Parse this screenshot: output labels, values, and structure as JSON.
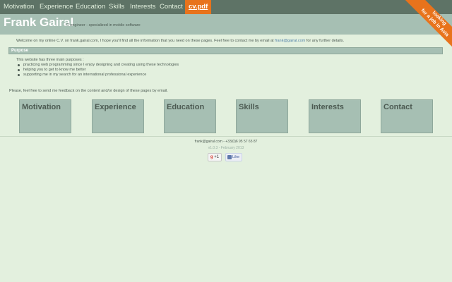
{
  "nav": {
    "items": [
      {
        "label": "Motivation"
      },
      {
        "label": "Experience"
      },
      {
        "label": "Education"
      },
      {
        "label": "Skills"
      },
      {
        "label": "Interests"
      },
      {
        "label": "Contact"
      }
    ],
    "cv_label": "cv.pdf"
  },
  "header": {
    "name": "Frank Gairal",
    "tagline": "IT engineer - specialized in mobile software"
  },
  "ribbon": {
    "line1": "looking",
    "line2": "for a job in Asia"
  },
  "content": {
    "welcome_text": "Welcome on my online C.V. on frank.gairal.com, I hope you'll find all the information that you need on these pages. Feel free to contact me by email at ",
    "welcome_email": "frank@gairal.com",
    "welcome_suffix": " for any further details.",
    "section_title": "Purpose",
    "intro": "This website has three main purposes :",
    "purposes": [
      "practicing web programming since I enjoy designing and creating using these technologies",
      "helping you to get to know me better",
      "supporting me in my search for an international professional experience"
    ],
    "feedback": "Please, feel free to send me feedback on the content and/or design of these pages by email."
  },
  "tiles": [
    {
      "label": "Motivation"
    },
    {
      "label": "Experience"
    },
    {
      "label": "Education"
    },
    {
      "label": "Skills"
    },
    {
      "label": "Interests"
    },
    {
      "label": "Contact"
    }
  ],
  "footer": {
    "contact": "frank@gairal.com - +33(0)6 95 57 65 87",
    "version": "v1.0.3 - February 2013",
    "gplus_label": "+1",
    "like_label": "Like"
  },
  "colors": {
    "nav_bg": "#5e7366",
    "accent": "#e8731c",
    "band": "#a6bfb3",
    "page_bg": "#e3f0de"
  }
}
